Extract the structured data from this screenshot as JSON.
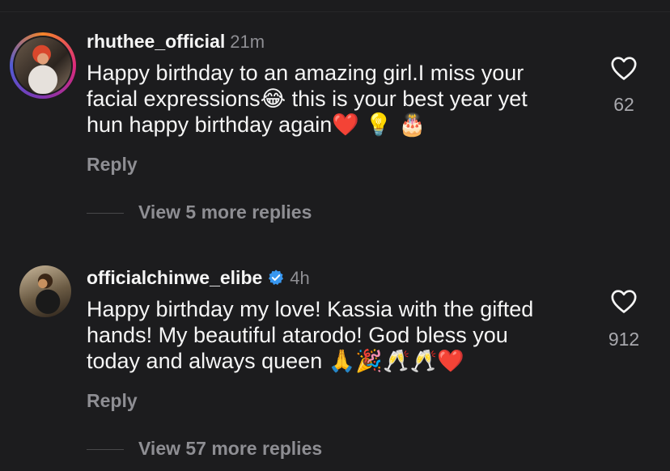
{
  "comments": [
    {
      "username": "rhuthee_official",
      "time": "21m",
      "lines": [
        "Happy birthday to an amazing girl.I miss your",
        "facial expressions😂 this is your best year yet",
        "hun happy birthday again❤️ 💡 🎂"
      ],
      "reply_label": "Reply",
      "likes": "62",
      "view_more": "View 5 more replies",
      "verified": false
    },
    {
      "username": "officialchinwe_elibe",
      "time": "4h",
      "lines": [
        "Happy birthday my love! Kassia with the gifted",
        "hands! My beautiful atarodo! God bless you",
        "today and always queen 🙏🎉🥂🥂❤️"
      ],
      "reply_label": "Reply",
      "likes": "912",
      "view_more": "View 57 more replies",
      "verified": true
    }
  ],
  "colors": {
    "background": "#1c1c1e",
    "text": "#f5f5f5",
    "muted": "#8e8e93",
    "verified_badge": "#3897f0"
  },
  "icons": {
    "like": "heart-outline-icon",
    "verified": "verified-badge-icon"
  }
}
